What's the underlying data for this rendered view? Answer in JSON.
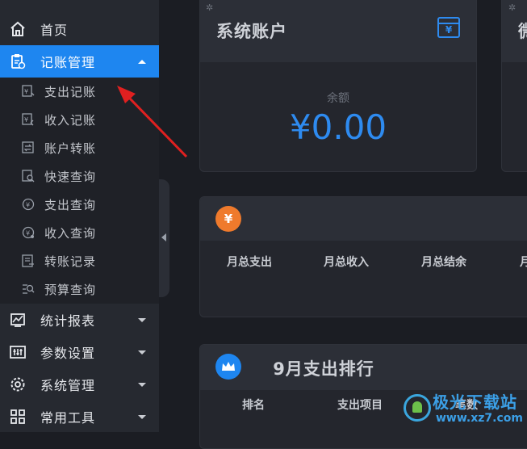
{
  "sidebar": {
    "home": {
      "label": "首页",
      "icon": "home-icon"
    },
    "bookkeeping": {
      "label": "记账管理",
      "icon": "clipboard-icon"
    },
    "sub_items": [
      {
        "label": "支出记账",
        "icon": "expense-record-icon"
      },
      {
        "label": "收入记账",
        "icon": "income-record-icon"
      },
      {
        "label": "账户转账",
        "icon": "transfer-icon"
      },
      {
        "label": "快速查询",
        "icon": "quick-search-icon"
      },
      {
        "label": "支出查询",
        "icon": "expense-query-icon"
      },
      {
        "label": "收入查询",
        "icon": "income-query-icon"
      },
      {
        "label": "转账记录",
        "icon": "transfer-log-icon"
      },
      {
        "label": "预算查询",
        "icon": "budget-query-icon"
      }
    ],
    "reports": {
      "label": "统计报表",
      "icon": "chart-icon"
    },
    "params": {
      "label": "参数设置",
      "icon": "sliders-icon"
    },
    "system": {
      "label": "系统管理",
      "icon": "gear-icon"
    },
    "tools": {
      "label": "常用工具",
      "icon": "grid-icon"
    }
  },
  "account_card": {
    "title": "系统账户",
    "wallet_glyph": "¥",
    "balance_label": "余额",
    "balance_value": "¥0.00"
  },
  "side_card": {
    "title_partial": "微"
  },
  "monthly_card": {
    "badge_glyph": "¥",
    "columns": [
      "月总支出",
      "月总收入",
      "月总结余",
      "月"
    ]
  },
  "ranking_card": {
    "title": "9月支出排行",
    "columns": [
      "排名",
      "支出项目",
      "笔数"
    ]
  },
  "watermark": {
    "line1": "极光下载站",
    "line2": "www.xz7.com"
  },
  "colors": {
    "accent": "#1e86f0",
    "balance": "#2e8bf0",
    "badge_orange": "#ef7a2c",
    "arrow": "#e02020"
  }
}
